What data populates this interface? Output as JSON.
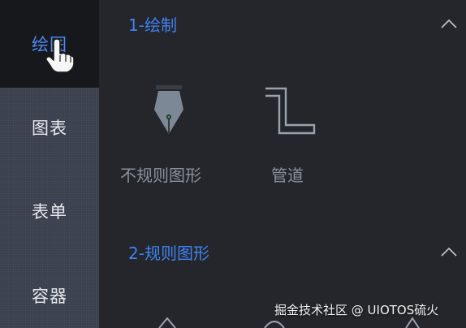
{
  "sidebar": {
    "items": [
      {
        "label": "绘图",
        "active": true
      },
      {
        "label": "图表",
        "active": false
      },
      {
        "label": "表单",
        "active": false
      },
      {
        "label": "容器",
        "active": false
      }
    ]
  },
  "sections": [
    {
      "title": "1-绘制",
      "collapse_icon": "chevron-up-icon",
      "tools": [
        {
          "label": "不规则图形",
          "icon": "pen-nib-icon"
        },
        {
          "label": "管道",
          "icon": "pipe-icon"
        }
      ]
    },
    {
      "title": "2-规则图形",
      "collapse_icon": "chevron-up-icon"
    }
  ],
  "watermark": "掘金技术社区 @ UIOTOS硫火",
  "colors": {
    "accent": "#3f83f2",
    "sidebar_bg": "#3a3f4d",
    "active_bg": "#17181b",
    "main_bg": "#24262b",
    "tool_label": "#8a919c"
  }
}
